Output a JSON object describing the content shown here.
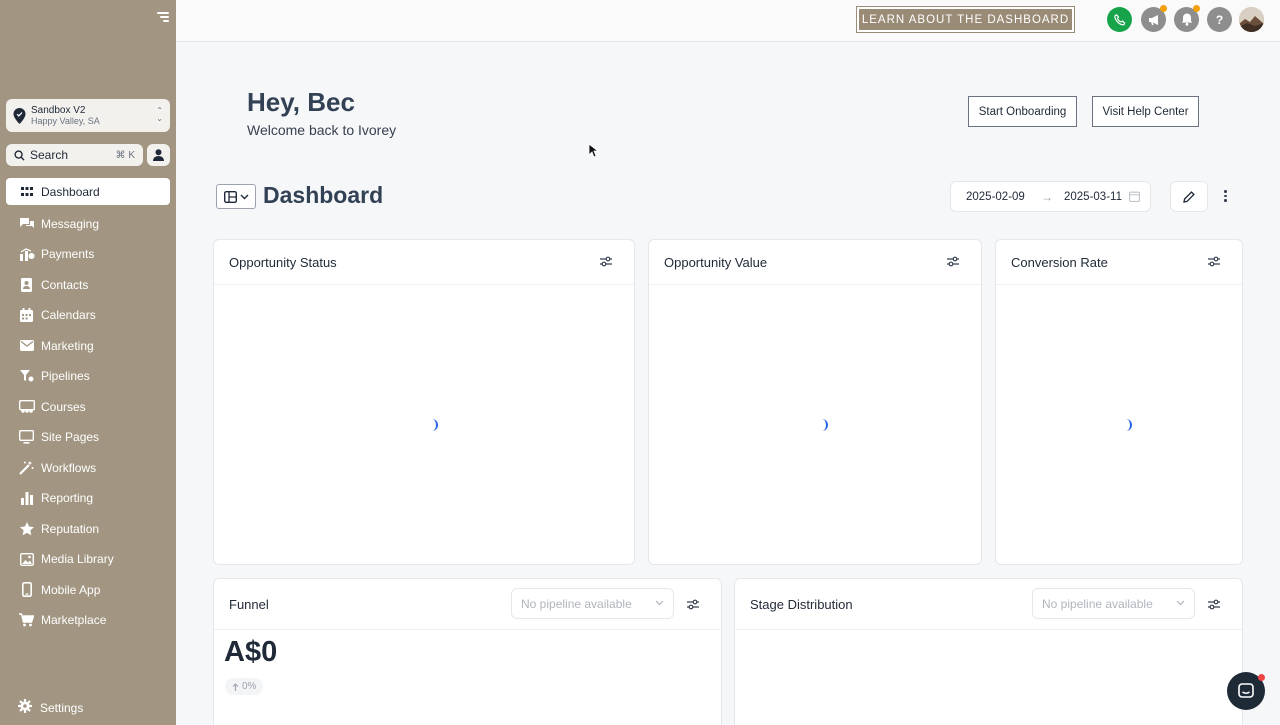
{
  "sidebar": {
    "location": {
      "name": "Sandbox V2",
      "sub": "Happy Valley, SA"
    },
    "search": {
      "label": "Search",
      "shortcut": "⌘ K"
    },
    "items": [
      {
        "label": "Dashboard",
        "icon": "grid-icon",
        "active": true
      },
      {
        "label": "Messaging",
        "icon": "chat-icon"
      },
      {
        "label": "Payments",
        "icon": "payments-icon"
      },
      {
        "label": "Contacts",
        "icon": "contacts-icon"
      },
      {
        "label": "Calendars",
        "icon": "calendar-icon"
      },
      {
        "label": "Marketing",
        "icon": "envelope-icon"
      },
      {
        "label": "Pipelines",
        "icon": "funnel-icon"
      },
      {
        "label": "Courses",
        "icon": "courses-icon"
      },
      {
        "label": "Site Pages",
        "icon": "monitor-icon"
      },
      {
        "label": "Workflows",
        "icon": "wand-icon"
      },
      {
        "label": "Reporting",
        "icon": "bar-chart-icon"
      },
      {
        "label": "Reputation",
        "icon": "star-icon"
      },
      {
        "label": "Media Library",
        "icon": "image-icon"
      },
      {
        "label": "Mobile App",
        "icon": "phone-icon"
      },
      {
        "label": "Marketplace",
        "icon": "cart-icon"
      }
    ],
    "settings_label": "Settings"
  },
  "topbar": {
    "learn_label": "LEARN ABOUT THE DASHBOARD",
    "help_glyph": "?",
    "colors": {
      "phone": "#16a34a",
      "grey": "#8e8e8e",
      "accent": "#9a8b76"
    }
  },
  "welcome": {
    "greeting": "Hey, Bec",
    "subtitle": "Welcome back to Ivorey",
    "onboarding_label": "Start Onboarding",
    "help_label": "Visit Help Center"
  },
  "dashboard": {
    "title": "Dashboard",
    "date_start": "2025-02-09",
    "date_arrow": "→",
    "date_end": "2025-03-11"
  },
  "cards": {
    "opportunity_status": "Opportunity Status",
    "opportunity_value": "Opportunity Value",
    "conversion_rate": "Conversion Rate",
    "funnel": {
      "title": "Funnel",
      "select_placeholder": "No pipeline available",
      "amount": "A$0",
      "change": "0%"
    },
    "stage_distribution": {
      "title": "Stage Distribution",
      "select_placeholder": "No pipeline available"
    }
  }
}
